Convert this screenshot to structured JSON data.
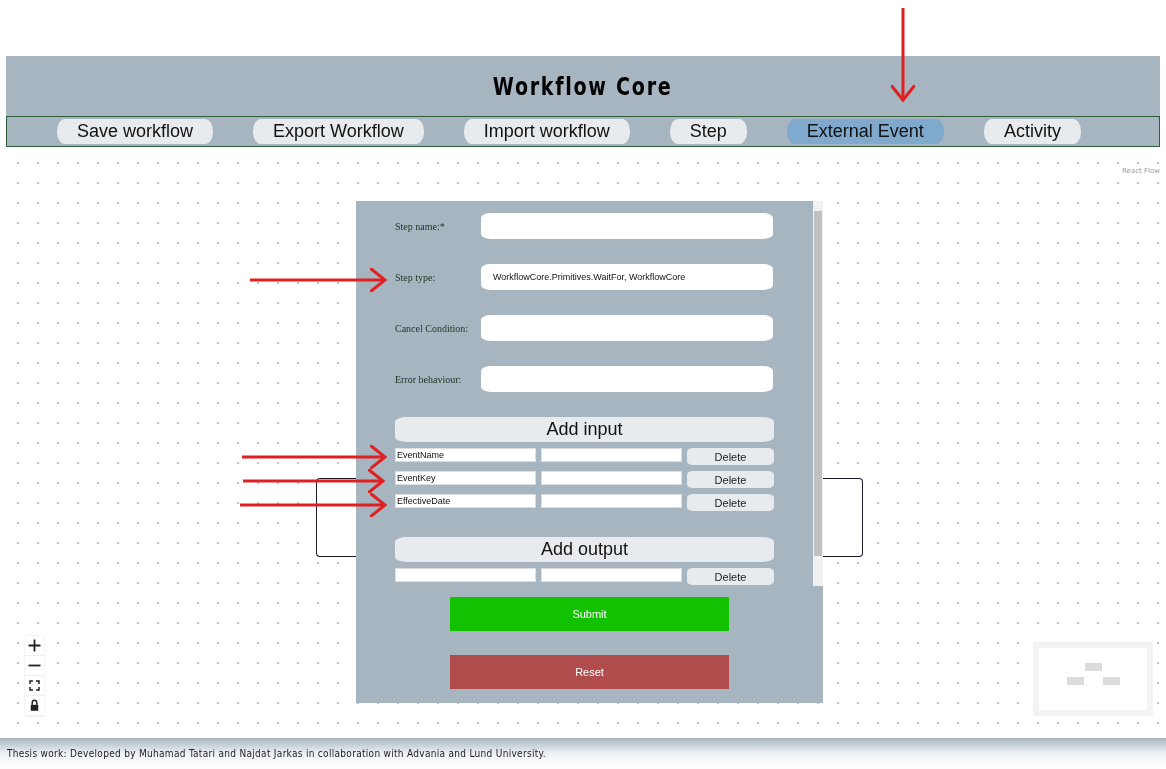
{
  "header": {
    "title": "Workflow Core"
  },
  "nav": [
    {
      "label": "Save workflow",
      "selected": false
    },
    {
      "label": "Export Workflow",
      "selected": false
    },
    {
      "label": "Import workflow",
      "selected": false
    },
    {
      "label": "Step",
      "selected": false
    },
    {
      "label": "External Event",
      "selected": true
    },
    {
      "label": "Activity",
      "selected": false
    }
  ],
  "canvas": {
    "attribution": "React Flow"
  },
  "form": {
    "fields": [
      {
        "label": "Step name:*"
      },
      {
        "label": "Step type:",
        "value": "WorkflowCore.Primitives.WaitFor, WorkflowCore"
      },
      {
        "label": "Cancel Condition:"
      },
      {
        "label": "Error behaviour:"
      }
    ],
    "input_section": {
      "title": "Add input",
      "rows": [
        {
          "name": "EventName",
          "button": "Delete"
        },
        {
          "name": "EventKey",
          "button": "Delete"
        },
        {
          "name": "EffectiveDate",
          "button": "Delete"
        }
      ]
    },
    "output_section": {
      "title": "Add output",
      "rows": [
        {
          "button": "Delete"
        }
      ]
    },
    "submit": "Submit",
    "reset": "Reset"
  },
  "footer": {
    "text": "Thesis work: Developed by Muhamad Tatari and Najdat Jarkas in collaboration with Advania and Lund University."
  }
}
